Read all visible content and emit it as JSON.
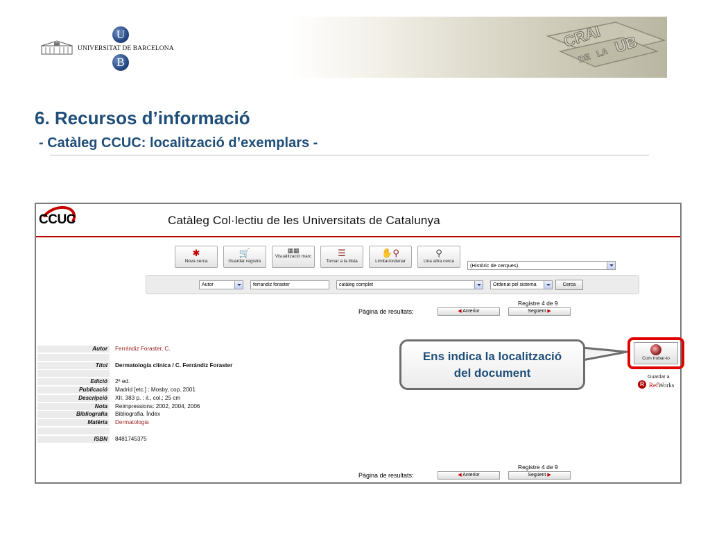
{
  "header": {
    "university_name": "UNIVERSITAT DE BARCELONA",
    "logo_letter_top": "U",
    "logo_letter_bottom": "B",
    "banner_text": [
      "CRAI",
      "DE",
      "LA",
      "UB"
    ]
  },
  "slide": {
    "title": "6. Recursos d’informació",
    "subtitle": "-  Catàleg CCUC: localització d’exemplars  -",
    "accent_color": "#1f4e79"
  },
  "catalog": {
    "logo_text": "CCUC",
    "title": "Catàleg Col·lectiu de les Universitats de Catalunya",
    "toolbar": [
      {
        "icon": "asterisk-icon",
        "label": "Nova cerca"
      },
      {
        "icon": "cart-icon",
        "label": "Guardar registre"
      },
      {
        "icon": "marc-icon",
        "label": "Visualització marc"
      },
      {
        "icon": "list-icon",
        "label": "Tornar a la llista"
      },
      {
        "icon": "filter-icon",
        "label": "Limitar/ordenar"
      },
      {
        "icon": "search-icon",
        "label": "Una altra cerca"
      }
    ],
    "history_select": "(Històric de cerques)",
    "search": {
      "field": "Autor",
      "query": "ferrandiz foraster",
      "scope": "catàleg complet",
      "sort": "Ordenat pel sistema",
      "button": "Cerca"
    },
    "pager": {
      "record_info": "Registre 4 de 9",
      "label": "Pàgina de resultats:",
      "prev": "Anterior",
      "next": "Següent"
    },
    "record": [
      {
        "key": "Autor",
        "value": "Ferrándiz Foraster, C.",
        "style": "red"
      },
      {
        "key": "",
        "value": "",
        "style": ""
      },
      {
        "key": "Títol",
        "value": "Dermatología clínica / C. Ferrándiz Foraster",
        "style": "bold"
      },
      {
        "key": "",
        "value": "",
        "style": ""
      },
      {
        "key": "Edició",
        "value": "2ª ed.",
        "style": ""
      },
      {
        "key": "Publicació",
        "value": "Madrid [etc.] : Mosby, cop. 2001",
        "style": ""
      },
      {
        "key": "Descripció",
        "value": "XII, 383 p. : il., col.; 25 cm",
        "style": ""
      },
      {
        "key": "Nota",
        "value": "Reimpressions: 2002, 2004, 2006",
        "style": ""
      },
      {
        "key": "Bibliografia",
        "value": "Bibliografia. Índex",
        "style": ""
      },
      {
        "key": "Matèria",
        "value": "Dermatologia",
        "style": "red"
      },
      {
        "key": "",
        "value": "",
        "style": ""
      },
      {
        "key": "ISBN",
        "value": "8481745375",
        "style": ""
      }
    ],
    "find_button": "Com trobar-lo",
    "refworks": {
      "save_label": "Guardar a",
      "brand_prefix": "Ref",
      "brand_suffix": "Works"
    }
  },
  "callout": {
    "line1": "Ens indica la localització",
    "line2": "del document"
  }
}
